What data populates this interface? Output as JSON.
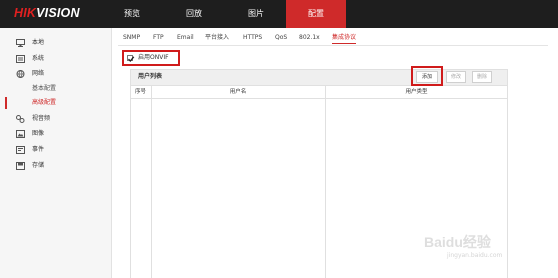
{
  "app": {
    "logo_red": "HIK",
    "logo_white": "VISION"
  },
  "top_nav": [
    {
      "label": "预览",
      "active": false
    },
    {
      "label": "回放",
      "active": false
    },
    {
      "label": "图片",
      "active": false
    },
    {
      "label": "配置",
      "active": true
    }
  ],
  "sidebar": {
    "items": [
      {
        "label": "本地",
        "icon": "monitor-icon"
      },
      {
        "label": "系统",
        "icon": "system-icon"
      },
      {
        "label": "网络",
        "icon": "globe-icon"
      },
      {
        "label": "基本配置",
        "sub": true,
        "active": false
      },
      {
        "label": "高级配置",
        "sub": true,
        "active": true
      },
      {
        "label": "视音频",
        "icon": "audio-video-icon"
      },
      {
        "label": "图像",
        "icon": "image-icon"
      },
      {
        "label": "事件",
        "icon": "event-icon"
      },
      {
        "label": "存储",
        "icon": "storage-icon"
      }
    ]
  },
  "tabs": [
    {
      "label": "SNMP",
      "active": false
    },
    {
      "label": "FTP",
      "active": false
    },
    {
      "label": "Email",
      "active": false
    },
    {
      "label": "平台接入",
      "active": false
    },
    {
      "label": "HTTPS",
      "active": false
    },
    {
      "label": "QoS",
      "active": false
    },
    {
      "label": "802.1x",
      "active": false
    },
    {
      "label": "集成协议",
      "active": true
    }
  ],
  "onvif": {
    "label": "启用ONVIF",
    "checked": true
  },
  "user_list": {
    "title": "用户列表",
    "buttons": {
      "add": "添加",
      "edit": "修改",
      "delete": "删除"
    },
    "columns": [
      "序号",
      "用户名",
      "用户类型"
    ],
    "rows": []
  },
  "watermark": {
    "text": "Baidu经验",
    "sub": "jingyan.baidu.com"
  },
  "colors": {
    "accent": "#cf2a2a",
    "topbar": "#1e1e1e",
    "highlight_box": "#d01b1b"
  }
}
